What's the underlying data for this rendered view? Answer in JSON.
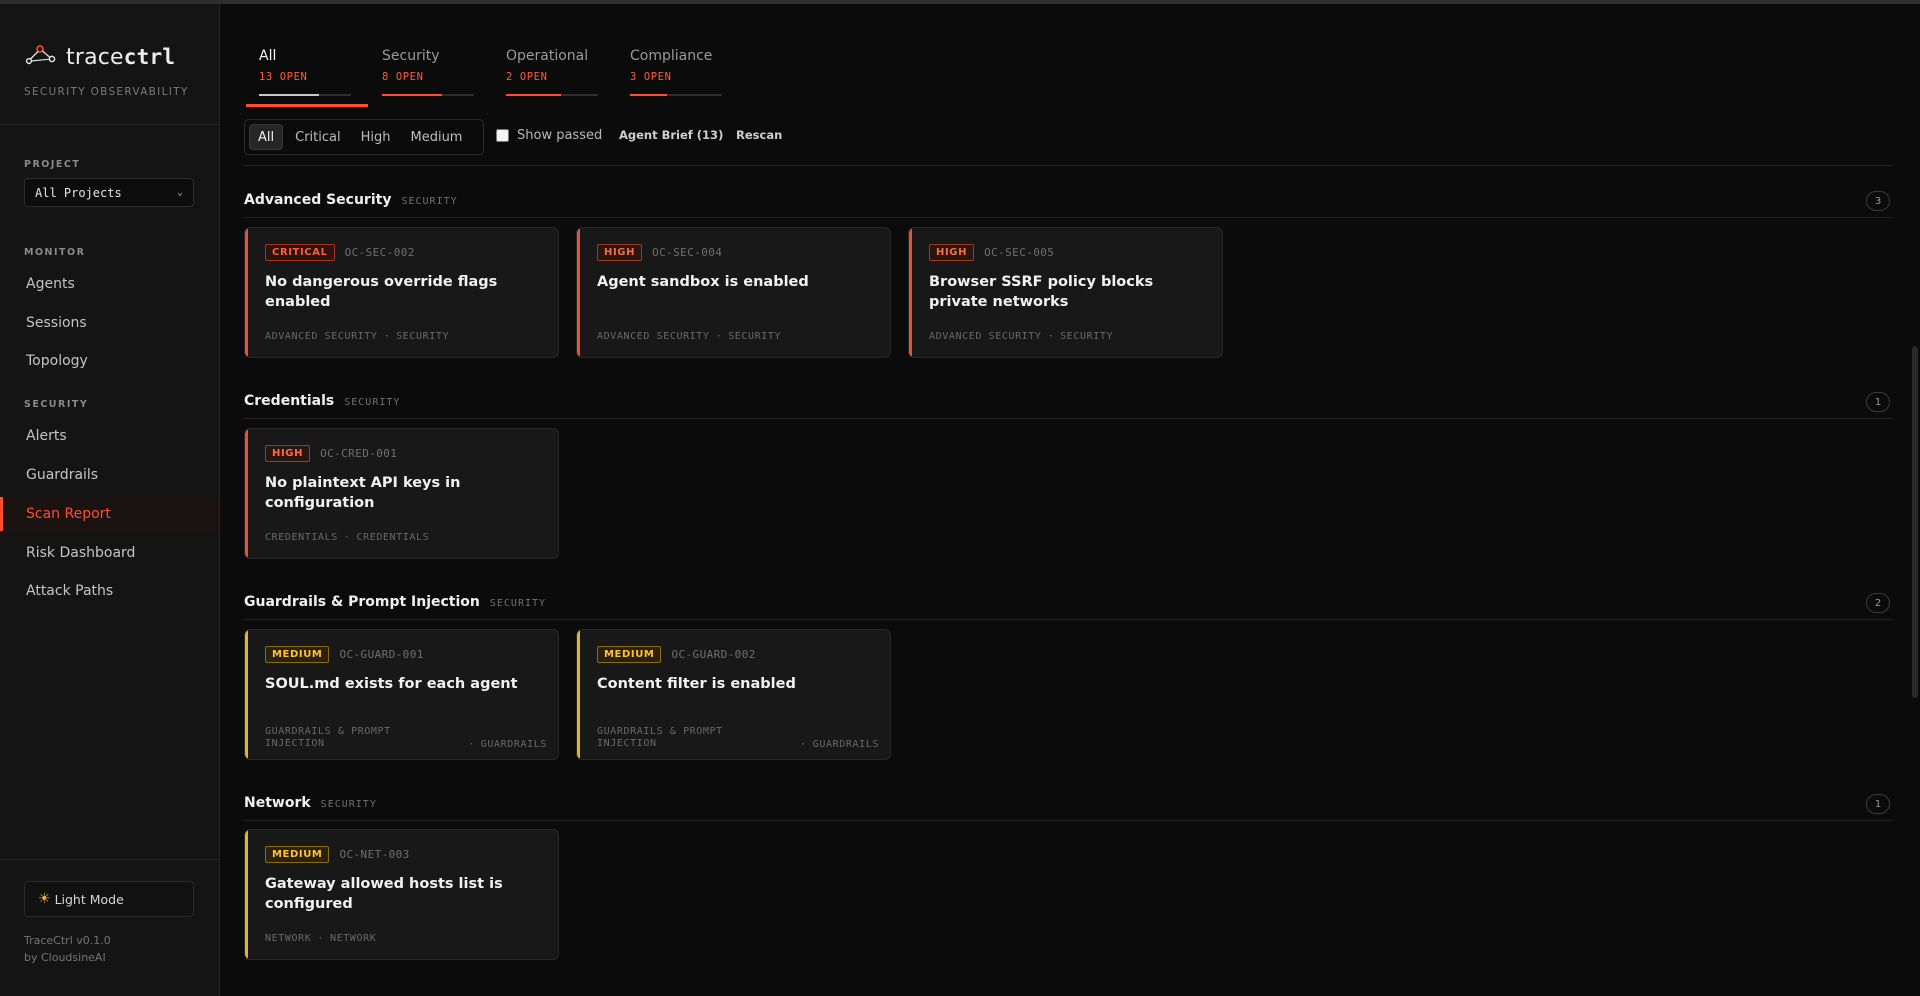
{
  "brand": {
    "prefix": "trace",
    "suffix": "ctrl",
    "tagline": "SECURITY OBSERVABILITY"
  },
  "sidebar": {
    "project_label": "PROJECT",
    "project_value": "All Projects",
    "monitor_label": "MONITOR",
    "monitor_items": [
      "Agents",
      "Sessions",
      "Topology"
    ],
    "security_label": "SECURITY",
    "security_items": [
      "Alerts",
      "Guardrails",
      "Scan Report",
      "Risk Dashboard",
      "Attack Paths"
    ],
    "active_item": "Scan Report",
    "light_mode": "Light Mode",
    "version": "TraceCtrl v0.1.0",
    "by": "by CloudsineAI"
  },
  "tabs": [
    {
      "name": "All",
      "open": "13 OPEN",
      "progress": 0.65
    },
    {
      "name": "Security",
      "open": "8 OPEN",
      "progress": 0.65
    },
    {
      "name": "Operational",
      "open": "2 OPEN",
      "progress": 0.6
    },
    {
      "name": "Compliance",
      "open": "3 OPEN",
      "progress": 0.4
    }
  ],
  "filters": {
    "options": [
      "All",
      "Critical",
      "High",
      "Medium"
    ],
    "active": "All",
    "show_passed": "Show passed",
    "agent_brief": "Agent Brief (13)",
    "rescan": "Rescan"
  },
  "groups": [
    {
      "title": "Advanced Security",
      "category": "SECURITY",
      "count": "3",
      "cards": [
        {
          "severity": "CRITICAL",
          "code": "OC-SEC-002",
          "title": "No dangerous override flags enabled",
          "section": "ADVANCED SECURITY",
          "category": "SECURITY"
        },
        {
          "severity": "HIGH",
          "code": "OC-SEC-004",
          "title": "Agent sandbox is enabled",
          "section": "ADVANCED SECURITY",
          "category": "SECURITY"
        },
        {
          "severity": "HIGH",
          "code": "OC-SEC-005",
          "title": "Browser SSRF policy blocks private networks",
          "section": "ADVANCED SECURITY",
          "category": "SECURITY"
        }
      ]
    },
    {
      "title": "Credentials",
      "category": "SECURITY",
      "count": "1",
      "cards": [
        {
          "severity": "HIGH",
          "code": "OC-CRED-001",
          "title": "No plaintext API keys in configuration",
          "section": "CREDENTIALS",
          "category": "CREDENTIALS"
        }
      ]
    },
    {
      "title": "Guardrails & Prompt Injection",
      "category": "SECURITY",
      "count": "2",
      "cards": [
        {
          "severity": "MEDIUM",
          "code": "OC-GUARD-001",
          "title": "SOUL.md exists for each agent",
          "section": "GUARDRAILS & PROMPT INJECTION",
          "category": "GUARDRAILS"
        },
        {
          "severity": "MEDIUM",
          "code": "OC-GUARD-002",
          "title": "Content filter is enabled",
          "section": "GUARDRAILS & PROMPT INJECTION",
          "category": "GUARDRAILS"
        }
      ]
    },
    {
      "title": "Network",
      "category": "SECURITY",
      "count": "1",
      "cards": [
        {
          "severity": "MEDIUM",
          "code": "OC-NET-003",
          "title": "Gateway allowed hosts list is configured",
          "section": "NETWORK",
          "category": "NETWORK"
        }
      ]
    }
  ],
  "colors": {
    "accent": "#ff4d2e",
    "high": "#e8503a",
    "medium": "#e6b422"
  }
}
